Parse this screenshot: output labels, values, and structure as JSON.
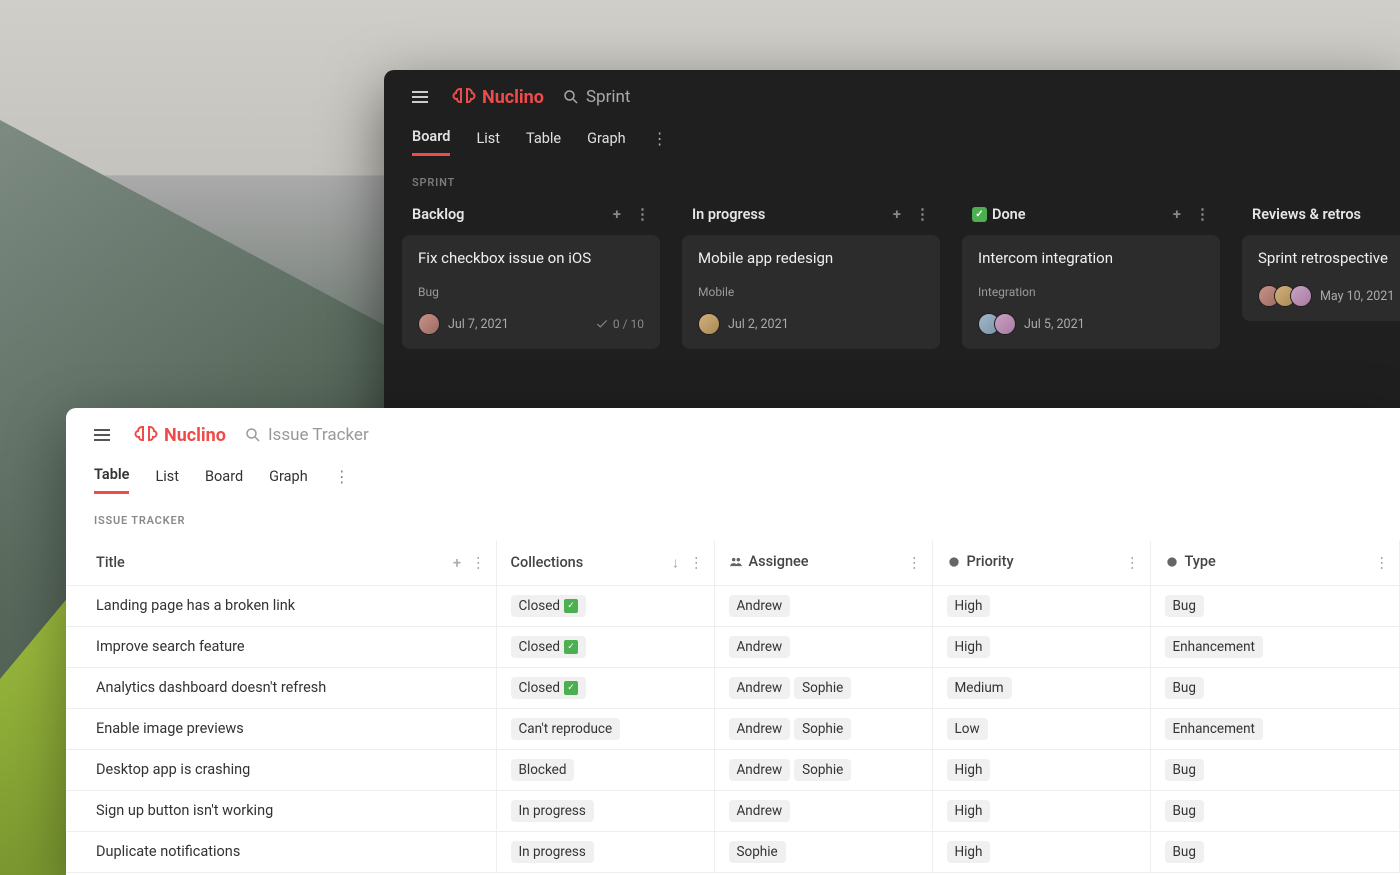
{
  "brand": "Nuclino",
  "dark": {
    "search_placeholder": "Sprint",
    "tabs": {
      "board": "Board",
      "list": "List",
      "table": "Table",
      "graph": "Graph"
    },
    "section": "SPRINT",
    "columns": [
      {
        "title": "Backlog",
        "done": false,
        "cards": [
          {
            "title": "Fix checkbox issue on iOS",
            "tag": "Bug",
            "date": "Jul 7, 2021",
            "checks": "0 / 10",
            "avatars": [
              "a1"
            ]
          }
        ]
      },
      {
        "title": "In progress",
        "done": false,
        "cards": [
          {
            "title": "Mobile app redesign",
            "tag": "Mobile",
            "date": "Jul 2, 2021",
            "checks": "",
            "avatars": [
              "a2"
            ]
          }
        ]
      },
      {
        "title": "Done",
        "done": true,
        "cards": [
          {
            "title": "Intercom integration",
            "tag": "Integration",
            "date": "Jul 5, 2021",
            "checks": "",
            "avatars": [
              "a3",
              "a4"
            ]
          }
        ]
      },
      {
        "title": "Reviews & retros",
        "done": false,
        "cards": [
          {
            "title": "Sprint retrospective",
            "tag": "",
            "date": "May 10, 2021",
            "checks": "",
            "avatars": [
              "a1",
              "a2",
              "a4"
            ]
          }
        ]
      }
    ]
  },
  "light": {
    "search_placeholder": "Issue Tracker",
    "tabs": {
      "table": "Table",
      "list": "List",
      "board": "Board",
      "graph": "Graph"
    },
    "section": "ISSUE TRACKER",
    "columns": {
      "title": "Title",
      "collections": "Collections",
      "assignee": "Assignee",
      "priority": "Priority",
      "type": "Type"
    },
    "rows": [
      {
        "title": "Landing page has a broken link",
        "collection": "Closed",
        "closed": true,
        "assignees": [
          "Andrew"
        ],
        "priority": "High",
        "type": "Bug"
      },
      {
        "title": "Improve search feature",
        "collection": "Closed",
        "closed": true,
        "assignees": [
          "Andrew"
        ],
        "priority": "High",
        "type": "Enhancement"
      },
      {
        "title": "Analytics dashboard doesn't refresh",
        "collection": "Closed",
        "closed": true,
        "assignees": [
          "Andrew",
          "Sophie"
        ],
        "priority": "Medium",
        "type": "Bug"
      },
      {
        "title": "Enable image previews",
        "collection": "Can't reproduce",
        "closed": false,
        "assignees": [
          "Andrew",
          "Sophie"
        ],
        "priority": "Low",
        "type": "Enhancement"
      },
      {
        "title": "Desktop app is crashing",
        "collection": "Blocked",
        "closed": false,
        "assignees": [
          "Andrew",
          "Sophie"
        ],
        "priority": "High",
        "type": "Bug"
      },
      {
        "title": "Sign up button isn't working",
        "collection": "In progress",
        "closed": false,
        "assignees": [
          "Andrew"
        ],
        "priority": "High",
        "type": "Bug"
      },
      {
        "title": "Duplicate notifications",
        "collection": "In progress",
        "closed": false,
        "assignees": [
          "Sophie"
        ],
        "priority": "High",
        "type": "Bug"
      }
    ]
  }
}
